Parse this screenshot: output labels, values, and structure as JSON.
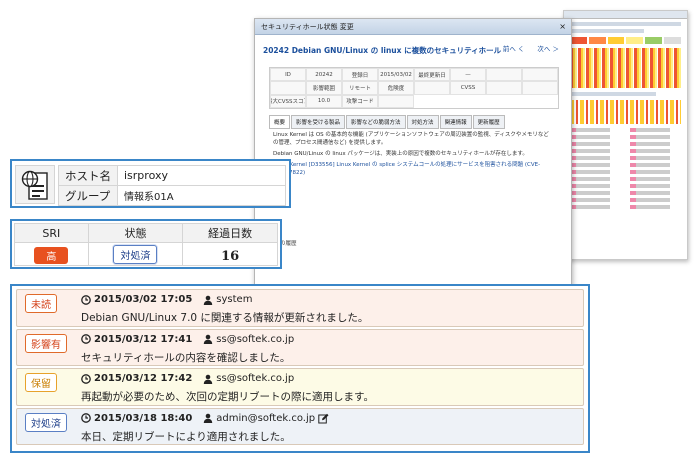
{
  "background_dialog": {
    "title": "セキュリティホール状態 変更",
    "heading": "20242 Debian GNU/Linux の linux に複数のセキュリティホール",
    "nav": "前へ く　　次へ ＞",
    "grid": [
      "ID",
      "20242",
      "登録日",
      "2015/03/02",
      "最終更新日",
      "—",
      "",
      "",
      "",
      "影響範囲",
      "リモート",
      "危険度",
      "",
      "CVSS",
      "",
      "",
      "最大CVSSスコア",
      "10.0",
      "攻撃コード",
      ""
    ],
    "tabs": [
      "概要",
      "影響を受ける製品",
      "影響などの脆弱方法",
      "対処方法",
      "関連情報",
      "更新履歴"
    ],
    "text1": "Linux Kernel は OS の基本的な機能 (アプリケーションソフトウェアの周辺装置の監視、ディスクやメモリなどの管理、プロセス間通信など) を提供します。",
    "text2": "Debian GNU/Linux の linux パッケージは、実装上の原因で複数のセキュリティホールが存在します。",
    "text3": "Linux Kernel [D33556] Linux Kernel の splice システムコールの処理にサービスを阻害される問題 (CVE-2014-7822)",
    "footer": "対応の履歴"
  },
  "host": {
    "host_label": "ホスト名",
    "host_value": "isrproxy",
    "group_label": "グループ",
    "group_value": "情報系01A"
  },
  "status": {
    "headers": [
      "SRI",
      "状態",
      "経過日数"
    ],
    "sri": "高",
    "state": "対処済",
    "days": "16"
  },
  "log": [
    {
      "tag": "未読",
      "time": "2015/03/02 17:05",
      "user": "system",
      "message": "Debian GNU/Linux 7.0 に関連する情報が更新されました。"
    },
    {
      "tag": "影響有",
      "time": "2015/03/12 17:41",
      "user": "ss@softek.co.jp",
      "message": "セキュリティホールの内容を確認しました。"
    },
    {
      "tag": "保留",
      "time": "2015/03/12 17:42",
      "user": "ss@softek.co.jp",
      "message": "再起動が必要のため、次回の定期リブートの際に適用します。"
    },
    {
      "tag": "対処済",
      "time": "2015/03/18 18:40",
      "user": "admin@softek.co.jp",
      "message": "本日、定期リブートにより適用されました。"
    }
  ],
  "colors": {
    "accent": "#3a86c8",
    "red": "#e8511f",
    "orange": "#e7a22b",
    "blue": "#1e3f8a"
  }
}
